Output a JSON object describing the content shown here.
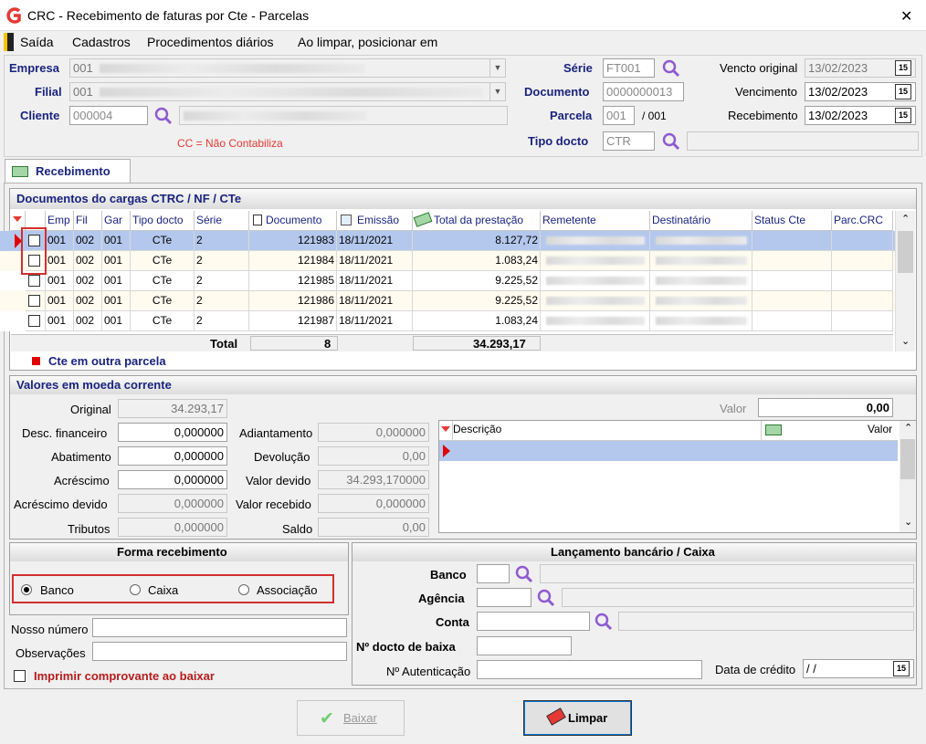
{
  "window": {
    "title": "CRC - Recebimento de faturas por Cte - Parcelas",
    "close": "✕"
  },
  "menu": {
    "items": [
      "Saída",
      "Cadastros",
      "Procedimentos diários",
      "Ao limpar, posicionar em"
    ]
  },
  "header": {
    "empresa_label": "Empresa",
    "empresa_value": "001",
    "filial_label": "Filial",
    "filial_value": "001",
    "cliente_label": "Cliente",
    "cliente_value": "000004",
    "cc_note": "CC = Não Contabiliza",
    "serie_label": "Série",
    "serie_value": "FT001",
    "documento_label": "Documento",
    "documento_value": "0000000013",
    "parcela_label": "Parcela",
    "parcela_value": "001",
    "parcela_total": "/ 001",
    "tipo_docto_label": "Tipo docto",
    "tipo_docto_value": "CTR",
    "vencto_original_label": "Vencto original",
    "vencto_original_value": "13/02/2023",
    "vencimento_label": "Vencimento",
    "vencimento_value": "13/02/2023",
    "recebimento_label": "Recebimento",
    "recebimento_value": "13/02/2023",
    "calendar_glyph": "15"
  },
  "tab": {
    "label": "Recebimento"
  },
  "documents": {
    "title": "Documentos do cargas CTRC / NF / CTe",
    "columns": [
      "Emp",
      "Fil",
      "Gar",
      "Tipo docto",
      "Série",
      "Documento",
      "Emissão",
      "Total da prestação",
      "Remetente",
      "Destinatário",
      "Status Cte",
      "Parc.CRC"
    ],
    "rows": [
      [
        "001",
        "002",
        "001",
        "CTe",
        "2",
        "121983",
        "18/11/2021",
        "8.127,72"
      ],
      [
        "001",
        "002",
        "001",
        "CTe",
        "2",
        "121984",
        "18/11/2021",
        "1.083,24"
      ],
      [
        "001",
        "002",
        "001",
        "CTe",
        "2",
        "121985",
        "18/11/2021",
        "9.225,52"
      ],
      [
        "001",
        "002",
        "001",
        "CTe",
        "2",
        "121986",
        "18/11/2021",
        "9.225,52"
      ],
      [
        "001",
        "002",
        "001",
        "CTe",
        "2",
        "121987",
        "18/11/2021",
        "1.083,24"
      ]
    ],
    "total_label": "Total",
    "total_count": "8",
    "total_value": "34.293,17",
    "legend": "Cte em outra parcela"
  },
  "valores": {
    "title": "Valores em moeda corrente",
    "original_label": "Original",
    "original_value": "34.293,17",
    "desc_fin_label": "Desc. financeiro",
    "desc_fin_value": "0,000000",
    "abatimento_label": "Abatimento",
    "abatimento_value": "0,000000",
    "acrescimo_label": "Acréscimo",
    "acrescimo_value": "0,000000",
    "acrescimo_devido_label": "Acréscimo devido",
    "acrescimo_devido_value": "0,000000",
    "tributos_label": "Tributos",
    "tributos_value": "0,000000",
    "adiantamento_label": "Adiantamento",
    "adiantamento_value": "0,000000",
    "devolucao_label": "Devolução",
    "devolucao_value": "0,00",
    "valor_devido_label": "Valor devido",
    "valor_devido_value": "34.293,170000",
    "valor_recebido_label": "Valor recebido",
    "valor_recebido_value": "0,000000",
    "saldo_label": "Saldo",
    "saldo_value": "0,00",
    "valor_label": "Valor",
    "valor_value": "0,00",
    "desc_col": "Descrição",
    "valor_col": "Valor"
  },
  "forma": {
    "title": "Forma recebimento",
    "options": [
      "Banco",
      "Caixa",
      "Associação"
    ],
    "selected": "Banco",
    "nosso_numero_label": "Nosso número",
    "observacoes_label": "Observações",
    "imprimir_label": "Imprimir comprovante ao baixar"
  },
  "lancamento": {
    "title": "Lançamento bancário / Caixa",
    "banco_label": "Banco",
    "agencia_label": "Agência",
    "conta_label": "Conta",
    "docto_baixa_label": "Nº docto de baixa",
    "autenticacao_label": "Nº Autenticação",
    "data_credito_label": "Data de crédito",
    "data_credito_value": " /  /"
  },
  "buttons": {
    "baixar": "Baixar",
    "limpar": "Limpar"
  },
  "colors": {
    "accent": "#1a237e",
    "selected_row": "#b4c8ee",
    "highlight_red": "#d32f2f"
  }
}
